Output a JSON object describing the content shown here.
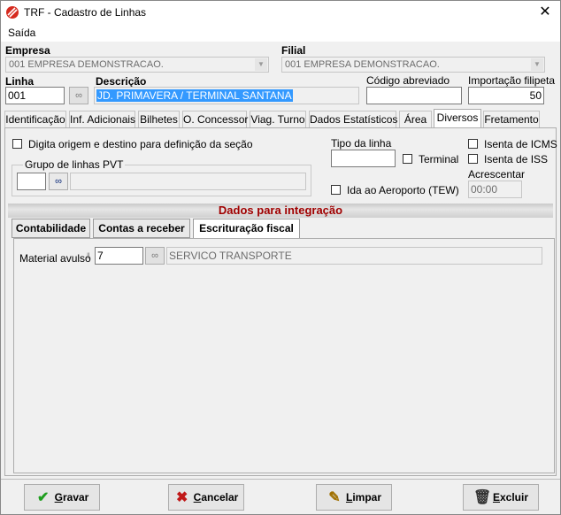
{
  "window": {
    "title": "TRF - Cadastro de Linhas",
    "close_label": "✕"
  },
  "menu": {
    "saida": "Saída"
  },
  "empresa": {
    "label": "Empresa",
    "value": "001 EMPRESA DEMONSTRACAO."
  },
  "filial": {
    "label": "Filial",
    "value": "001 EMPRESA DEMONSTRACAO."
  },
  "linha": {
    "label": "Linha",
    "value": "001"
  },
  "descricao": {
    "label": "Descrição",
    "value": "JD. PRIMAVERA / TERMINAL SANTANA"
  },
  "codigo_abreviado": {
    "label": "Código abreviado",
    "value": ""
  },
  "importacao_filipeta": {
    "label": "Importação filipeta",
    "value": "50"
  },
  "tabs": [
    {
      "label": "Identificação"
    },
    {
      "label": "Inf. Adicionais"
    },
    {
      "label": "Bilhetes"
    },
    {
      "label": "O. Concessor"
    },
    {
      "label": "Viag. Turno"
    },
    {
      "label": "Dados Estatísticos"
    },
    {
      "label": "Área"
    },
    {
      "label": "Diversos"
    },
    {
      "label": "Fretamento"
    }
  ],
  "diversos": {
    "digita_origem": "Digita origem e destino para definição da seção",
    "grupo_pvt_label": "Grupo de linhas PVT",
    "grupo_pvt_code": "",
    "grupo_pvt_desc": "",
    "tipo_linha_label": "Tipo da linha",
    "tipo_linha_value": "",
    "terminal": "Terminal",
    "ida_aeroporto": "Ida ao Aeroporto (TEW)",
    "isenta_icms": "Isenta de ICMS",
    "isenta_iss": "Isenta de ISS",
    "acrescentar_label": "Acrescentar",
    "acrescentar_value": "00:00"
  },
  "integracao": {
    "title": "Dados para integração",
    "subtabs": [
      {
        "label": "Contabilidade"
      },
      {
        "label": "Contas a receber"
      },
      {
        "label": "Escrituração fiscal"
      }
    ],
    "material_avulso_label": "Material avulso",
    "material_avulso_code": "7",
    "material_avulso_desc": "SERVICO TRANSPORTE"
  },
  "buttons": {
    "gravar": {
      "accel": "G",
      "rest": "ravar"
    },
    "cancelar": {
      "accel": "C",
      "rest": "ancelar"
    },
    "limpar": {
      "accel": "L",
      "rest": "impar"
    },
    "excluir": {
      "accel": "E",
      "rest": "xcluir"
    }
  },
  "colors": {
    "header_text": "#a00000",
    "selection": "#3399ff"
  }
}
